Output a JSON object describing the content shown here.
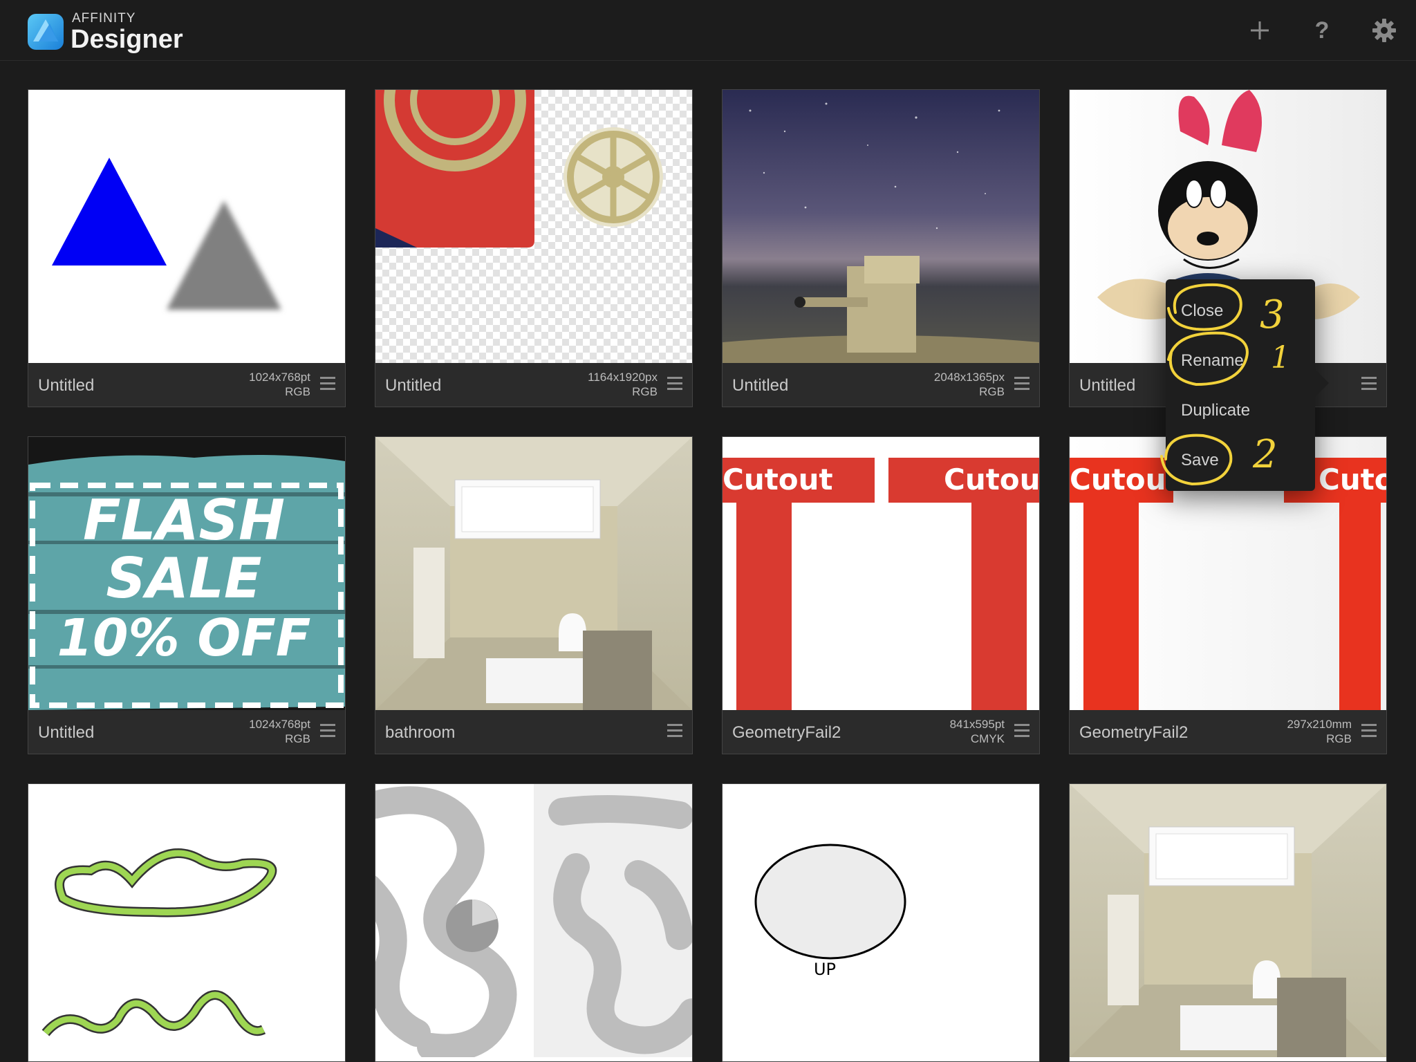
{
  "app": {
    "brand_small": "AFFINITY",
    "brand_big": "Designer",
    "accent": "#1a7fd8"
  },
  "toolbar": {
    "add_icon": "plus-icon",
    "help_label": "?",
    "settings_icon": "gear-icon"
  },
  "documents": [
    {
      "name": "Untitled",
      "size": "1024x768pt",
      "color": "RGB"
    },
    {
      "name": "Untitled",
      "size": "1164x1920px",
      "color": "RGB"
    },
    {
      "name": "Untitled",
      "size": "2048x1365px",
      "color": "RGB"
    },
    {
      "name": "Untitled",
      "size": "",
      "color": ""
    },
    {
      "name": "Untitled",
      "size": "1024x768pt",
      "color": "RGB"
    },
    {
      "name": "bathroom",
      "size": "",
      "color": ""
    },
    {
      "name": "GeometryFail2",
      "size": "841x595pt",
      "color": "CMYK"
    },
    {
      "name": "GeometryFail2",
      "size": "297x210mm",
      "color": "RGB"
    }
  ],
  "popup_menu": {
    "items": [
      "Close",
      "Rename",
      "Duplicate",
      "Save"
    ],
    "annotations": [
      "3",
      "1",
      "2"
    ]
  },
  "thumb_text": {
    "flash": [
      "FLASH",
      "SALE",
      "10% OFF"
    ],
    "cutout": "Cutout",
    "up": "UP"
  }
}
